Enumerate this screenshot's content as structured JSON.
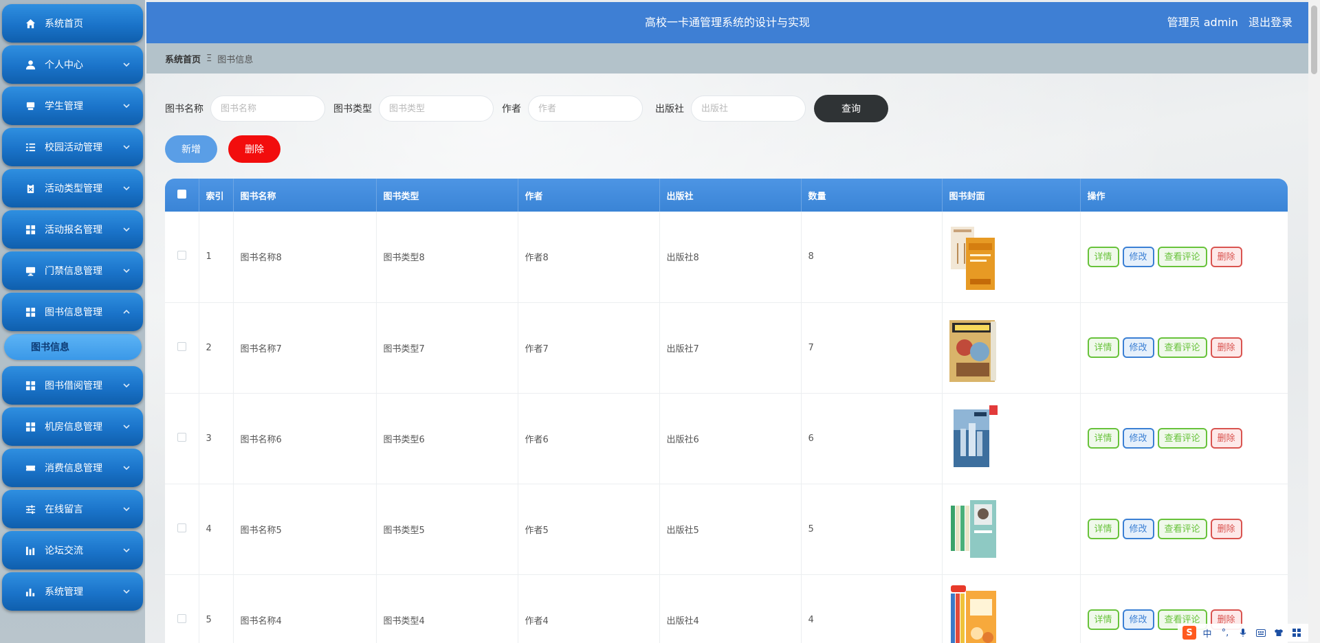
{
  "sidebar": {
    "items": [
      {
        "label": "系统首页",
        "icon": "home-icon",
        "has_arrow": false
      },
      {
        "label": "个人中心",
        "icon": "user-icon",
        "has_arrow": true
      },
      {
        "label": "学生管理",
        "icon": "id-card-icon",
        "has_arrow": true
      },
      {
        "label": "校园活动管理",
        "icon": "list-icon",
        "has_arrow": true
      },
      {
        "label": "活动类型管理",
        "icon": "clipboard-icon",
        "has_arrow": true
      },
      {
        "label": "活动报名管理",
        "icon": "grid-icon",
        "has_arrow": true
      },
      {
        "label": "门禁信息管理",
        "icon": "monitor-icon",
        "has_arrow": true
      },
      {
        "label": "图书信息管理",
        "icon": "grid-icon",
        "has_arrow": true,
        "expanded": true
      },
      {
        "label": "图书借阅管理",
        "icon": "grid-icon",
        "has_arrow": true
      },
      {
        "label": "机房信息管理",
        "icon": "grid-icon",
        "has_arrow": true
      },
      {
        "label": "消费信息管理",
        "icon": "ticket-icon",
        "has_arrow": true
      },
      {
        "label": "在线留言",
        "icon": "sliders-icon",
        "has_arrow": true
      },
      {
        "label": "论坛交流",
        "icon": "chart-icon",
        "has_arrow": true
      },
      {
        "label": "系统管理",
        "icon": "bar-chart-icon",
        "has_arrow": true
      }
    ],
    "submenu_active": "图书信息"
  },
  "header": {
    "title": "高校一卡通管理系统的设计与实现",
    "user_label": "管理员 admin",
    "logout_label": "退出登录"
  },
  "breadcrumb": {
    "home": "系统首页",
    "separator": "Ξ",
    "current": "图书信息"
  },
  "search": {
    "name_label": "图书名称",
    "name_placeholder": "图书名称",
    "type_label": "图书类型",
    "type_placeholder": "图书类型",
    "author_label": "作者",
    "author_placeholder": "作者",
    "publisher_label": "出版社",
    "publisher_placeholder": "出版社",
    "button_label": "查询"
  },
  "actions": {
    "add_label": "新增",
    "delete_label": "删除"
  },
  "table": {
    "columns": [
      "",
      "索引",
      "图书名称",
      "图书类型",
      "作者",
      "出版社",
      "数量",
      "图书封面",
      "操作"
    ],
    "rows": [
      {
        "index": "1",
        "name": "图书名称8",
        "type": "图书类型8",
        "author": "作者8",
        "publisher": "出版社8",
        "qty": "8"
      },
      {
        "index": "2",
        "name": "图书名称7",
        "type": "图书类型7",
        "author": "作者7",
        "publisher": "出版社7",
        "qty": "7"
      },
      {
        "index": "3",
        "name": "图书名称6",
        "type": "图书类型6",
        "author": "作者6",
        "publisher": "出版社6",
        "qty": "6"
      },
      {
        "index": "4",
        "name": "图书名称5",
        "type": "图书类型5",
        "author": "作者5",
        "publisher": "出版社5",
        "qty": "5"
      },
      {
        "index": "5",
        "name": "图书名称4",
        "type": "图书类型4",
        "author": "作者4",
        "publisher": "出版社4",
        "qty": "4"
      }
    ],
    "op_labels": {
      "detail": "详情",
      "edit": "修改",
      "comments": "查看评论",
      "delete": "删除"
    }
  },
  "ime": {
    "lang": "中",
    "punct": "°,"
  },
  "colors": {
    "header_bg": "#3e7fd4",
    "sidebar_btn": "#1a73c9",
    "search_btn": "#2f3335",
    "add_btn": "#5a9ee6",
    "delete_btn": "#f20d0d"
  }
}
